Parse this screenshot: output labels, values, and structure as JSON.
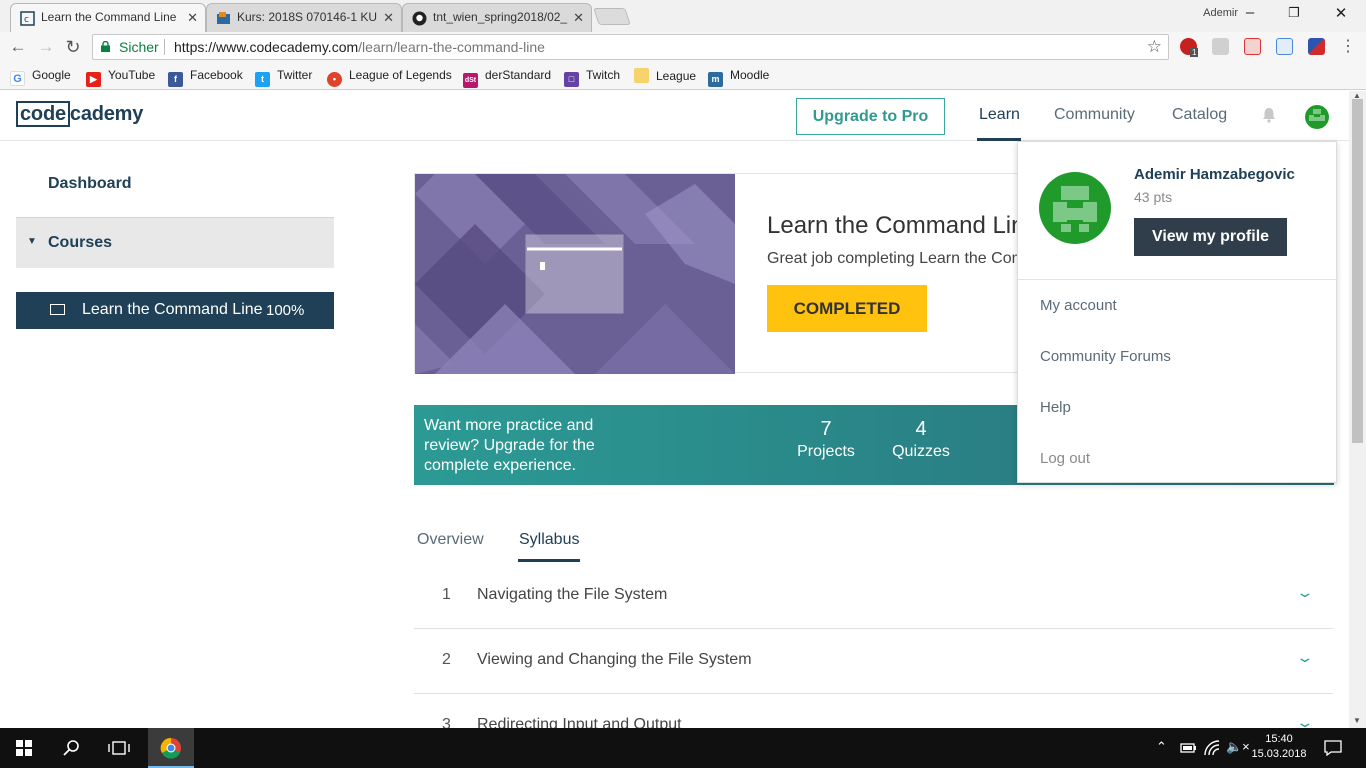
{
  "browser": {
    "tabs": [
      {
        "title": "Learn the Command Line",
        "favicon": "codecademy-favicon"
      },
      {
        "title": "Kurs: 2018S 070146-1 KU",
        "favicon": "moodle-favicon"
      },
      {
        "title": "tnt_wien_spring2018/02_",
        "favicon": "github-favicon"
      }
    ],
    "window_user": "Ademir",
    "secure_label": "Sicher",
    "url_prefix": "https://www.codecademy.com",
    "url_path": "/learn/learn-the-command-line",
    "bookmarks": [
      {
        "label": "Google",
        "icon": "google-icon"
      },
      {
        "label": "YouTube",
        "icon": "youtube-icon"
      },
      {
        "label": "Facebook",
        "icon": "facebook-icon"
      },
      {
        "label": "Twitter",
        "icon": "twitter-icon"
      },
      {
        "label": "League of Legends",
        "icon": "league-of-legends-icon"
      },
      {
        "label": "derStandard",
        "icon": "derstandard-icon"
      },
      {
        "label": "Twitch",
        "icon": "twitch-icon"
      },
      {
        "label": "League",
        "icon": "folder-icon"
      },
      {
        "label": "Moodle",
        "icon": "moodle-icon"
      }
    ],
    "extension_badge": "1"
  },
  "site": {
    "logo_boxed": "code",
    "logo_rest": "cademy",
    "upgrade_label": "Upgrade to Pro",
    "nav": [
      "Learn",
      "Community",
      "Catalog"
    ]
  },
  "sidebar": {
    "dashboard": "Dashboard",
    "courses": "Courses",
    "course_title": "Learn the Command Line",
    "course_progress": "100%"
  },
  "hero": {
    "title": "Learn the Command Line",
    "subtitle": "Great job completing Learn the Command Line",
    "status_label": "COMPLETED"
  },
  "upsell": {
    "text": "Want more practice and review? Upgrade for the complete experience.",
    "stats": [
      {
        "value": "7",
        "label": "Projects"
      },
      {
        "value": "4",
        "label": "Quizzes"
      }
    ]
  },
  "content_tabs": [
    "Overview",
    "Syllabus"
  ],
  "syllabus": [
    {
      "num": "1",
      "title": "Navigating the File System"
    },
    {
      "num": "2",
      "title": "Viewing and Changing the File System"
    },
    {
      "num": "3",
      "title": "Redirecting Input and Output"
    }
  ],
  "user_menu": {
    "name": "Ademir Hamzabegovic",
    "points": "43 pts",
    "profile_button": "View my profile",
    "items": [
      "My account",
      "Community Forums",
      "Help",
      "Log out"
    ]
  },
  "taskbar": {
    "time": "15:40",
    "date": "15.03.2018"
  },
  "colors": {
    "brand_navy": "#1f4056",
    "accent_teal": "#2f9a92",
    "completed_yellow": "#ffc20e",
    "avatar_green": "#1f9a2b"
  }
}
